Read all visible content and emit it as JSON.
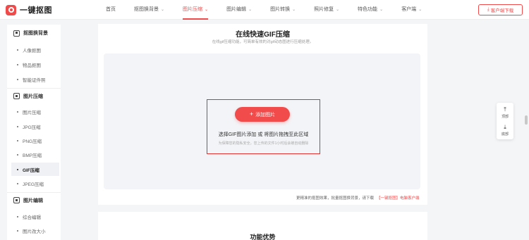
{
  "header": {
    "logo_text": "一键抠图",
    "nav": [
      {
        "label": "首页",
        "has_dropdown": false
      },
      {
        "label": "抠图换背景",
        "has_dropdown": true
      },
      {
        "label": "图片压缩",
        "has_dropdown": true,
        "active": true
      },
      {
        "label": "图片编辑",
        "has_dropdown": true
      },
      {
        "label": "图片转换",
        "has_dropdown": true
      },
      {
        "label": "照片修复",
        "has_dropdown": true
      },
      {
        "label": "特色功能",
        "has_dropdown": true
      },
      {
        "label": "客户端",
        "has_dropdown": true
      }
    ],
    "download_button": "客户端下载"
  },
  "sidebar": {
    "groups": [
      {
        "title": "抠图换背景",
        "items": [
          "人像抠图",
          "物品抠图",
          "智能证件照"
        ]
      },
      {
        "title": "图片压缩",
        "items": [
          "图片压缩",
          "JPG压缩",
          "PNG压缩",
          "BMP压缩",
          "GIF压缩",
          "JPEG压缩"
        ],
        "active_item": "GIF压缩"
      },
      {
        "title": "图片编辑",
        "items": [
          "综合编辑",
          "图片改大小"
        ]
      }
    ]
  },
  "main": {
    "title": "在线快速GIF压缩",
    "subtitle": "在线gif压缩功能，可简单有效的对gif动态图进行压缩处理。",
    "add_button": "添加图片",
    "drop_hint": "选择GIF图片添加 或 将图片拖拽至此区域",
    "privacy_note": "为保障您的隐私安全，您上传的文件1小时后会被自动删除",
    "footnote_text": "更精准的抠图效果，批量抠图换背景，请下载",
    "footnote_link": "【一键抠图】电脑客户端",
    "features_title": "功能优势"
  },
  "float_tools": {
    "top_label": "顶部",
    "bottom_label": "底部"
  },
  "colors": {
    "accent": "#f04b4b",
    "highlight_border": "#e03030",
    "page_bg": "#f4f5f7",
    "drop_area_bg": "#f3f4f7"
  }
}
